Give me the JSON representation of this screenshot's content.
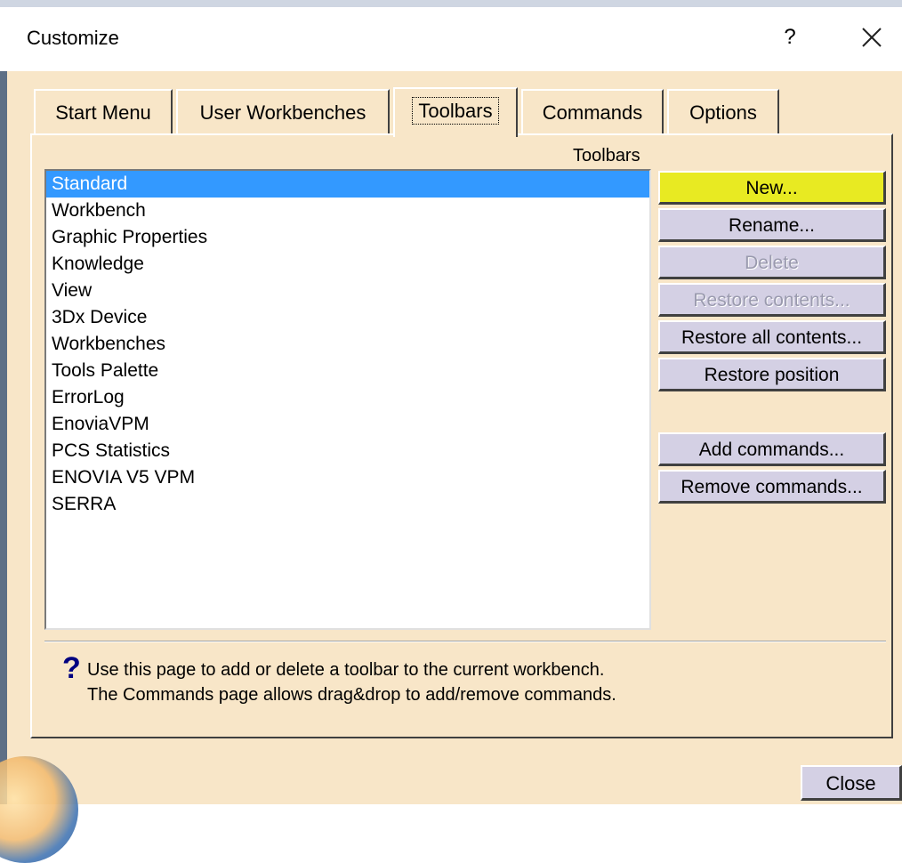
{
  "window": {
    "title": "Customize",
    "help_label": "?",
    "close_icon": "close-icon"
  },
  "tabs": [
    {
      "label": "Start Menu",
      "active": false
    },
    {
      "label": "User Workbenches",
      "active": false
    },
    {
      "label": "Toolbars",
      "active": true
    },
    {
      "label": "Commands",
      "active": false
    },
    {
      "label": "Options",
      "active": false
    }
  ],
  "toolbars_panel": {
    "group_label": "Toolbars",
    "items": [
      "Standard",
      "Workbench",
      "Graphic Properties",
      "Knowledge",
      "View",
      "3Dx Device",
      "Workbenches",
      "Tools Palette",
      "ErrorLog",
      "EnoviaVPM",
      "PCS Statistics",
      "ENOVIA V5 VPM",
      "SERRA"
    ],
    "selected_item": "Standard",
    "buttons": {
      "new": "New...",
      "rename": "Rename...",
      "delete": "Delete",
      "restore_contents": "Restore contents...",
      "restore_all_contents": "Restore all contents...",
      "restore_position": "Restore position",
      "add_commands": "Add commands...",
      "remove_commands": "Remove commands..."
    },
    "disabled_buttons": [
      "Delete",
      "Restore contents..."
    ],
    "highlighted_button": "New..."
  },
  "hint": {
    "icon": "question-icon",
    "line1": "Use this page to add or delete a toolbar to the current workbench.",
    "line2": "The Commands page allows drag&drop to add/remove commands."
  },
  "footer": {
    "close_label": "Close"
  },
  "colors": {
    "dialog_bg": "#f8e6c8",
    "selection": "#3399ff",
    "highlight": "#e8ea22",
    "button_bg": "#d4d0e4"
  }
}
